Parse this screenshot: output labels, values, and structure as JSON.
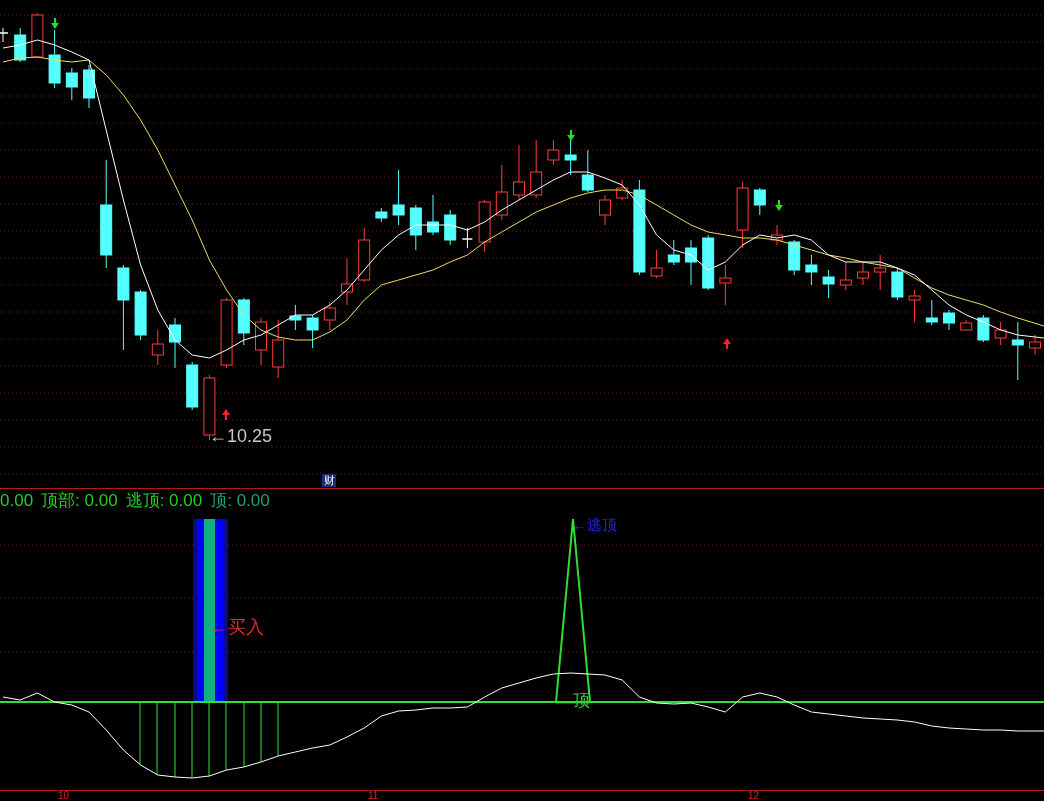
{
  "price_chart": {
    "price_label": "←10.25",
    "event_marker": "财"
  },
  "indicator": {
    "readings": [
      {
        "text": "0.00",
        "color": "#22cc22"
      },
      {
        "text": "顶部: 0.00",
        "color": "#22cc22"
      },
      {
        "text": "逃顶: 0.00",
        "color": "#22cc22"
      },
      {
        "text": "顶: 0.00",
        "color": "#1fa07a"
      }
    ],
    "signals": [
      {
        "kind": "buy",
        "label": "←买入"
      },
      {
        "kind": "escape",
        "label": "←逃顶"
      },
      {
        "kind": "top",
        "label": "顶"
      }
    ]
  },
  "time_axis": {
    "labels": [
      "10",
      "11",
      "12"
    ]
  }
}
